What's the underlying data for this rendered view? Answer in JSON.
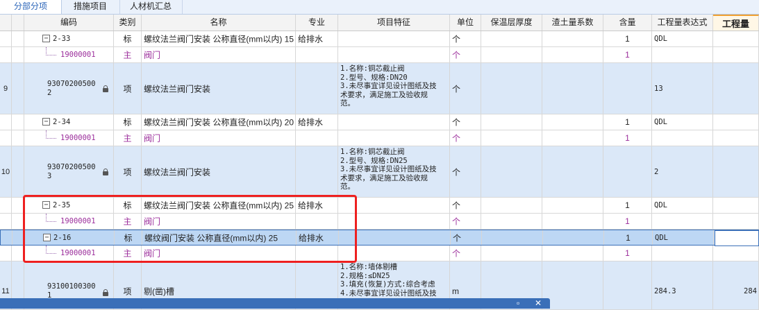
{
  "tabs": [
    {
      "label": "分部分项"
    },
    {
      "label": "措施项目"
    },
    {
      "label": "人材机汇总"
    }
  ],
  "columns": {
    "code": "编码",
    "category": "类别",
    "name": "名称",
    "specialty": "专业",
    "feature": "项目特征",
    "unit": "单位",
    "insulation": "保温层厚度",
    "soil": "渣土量系数",
    "content": "含量",
    "expr": "工程量表达式",
    "qty": "工程量"
  },
  "rows": [
    {
      "num": "",
      "code": "2-33",
      "category": "标",
      "name": "螺纹法兰阀门安装 公称直径(mm以内) 15",
      "specialty": "给排水",
      "unit": "个",
      "content": "1",
      "expr": "QDL",
      "qty": ""
    },
    {
      "num": "",
      "code": "19000001",
      "category": "主",
      "name": "阀门",
      "unit": "个",
      "content": "1"
    },
    {
      "num": "9",
      "code_l1": "93070200500",
      "code_l2": "2",
      "category": "项",
      "name": "螺纹法兰阀门安装",
      "feature": [
        "1.名称:铜芯截止阀",
        "2.型号、规格:DN20",
        "3.未尽事宜详见设计图纸及技",
        "术要求，满足施工及验收规",
        "范。"
      ],
      "unit": "个",
      "expr": "13",
      "qty": ""
    },
    {
      "num": "",
      "code": "2-34",
      "category": "标",
      "name": "螺纹法兰阀门安装 公称直径(mm以内) 20",
      "specialty": "给排水",
      "unit": "个",
      "content": "1",
      "expr": "QDL",
      "qty": ""
    },
    {
      "num": "",
      "code": "19000001",
      "category": "主",
      "name": "阀门",
      "unit": "个",
      "content": "1"
    },
    {
      "num": "10",
      "code_l1": "93070200500",
      "code_l2": "3",
      "category": "项",
      "name": "螺纹法兰阀门安装",
      "feature": [
        "1.名称:铜芯截止阀",
        "2.型号、规格:DN25",
        "3.未尽事宜详见设计图纸及技",
        "术要求，满足施工及验收规",
        "范。"
      ],
      "unit": "个",
      "expr": "2",
      "qty": ""
    },
    {
      "num": "",
      "code": "2-35",
      "category": "标",
      "name": "螺纹法兰阀门安装 公称直径(mm以内) 25",
      "specialty": "给排水",
      "unit": "个",
      "content": "1",
      "expr": "QDL",
      "qty": ""
    },
    {
      "num": "",
      "code": "19000001",
      "category": "主",
      "name": "阀门",
      "unit": "个",
      "content": "1"
    },
    {
      "num": "",
      "code": "2-16",
      "category": "标",
      "name": "螺纹阀门安装 公称直径(mm以内) 25",
      "specialty": "给排水",
      "unit": "个",
      "content": "1",
      "expr": "QDL",
      "qty": ""
    },
    {
      "num": "",
      "code": "19000001",
      "category": "主",
      "name": "阀门",
      "unit": "个",
      "content": "1"
    },
    {
      "num": "11",
      "code_l1": "93100100300",
      "code_l2": "1",
      "category": "项",
      "name": "剔(凿)槽",
      "feature": [
        "1.名称:墙体剔槽",
        "2.规格:≤DN25",
        "3.填充(恢复)方式:综合考虑",
        "4.未尽事宜详见设计图纸及技"
      ],
      "unit": "m",
      "expr": "284.3",
      "qty": "284"
    }
  ],
  "colors": {
    "accent": "#3a6fb8",
    "highlight_box": "#ee2020",
    "sub_text": "#9b2d9b",
    "item_row": "#dbe8f8",
    "selected_row": "#bdd7f4"
  },
  "bottom_icons": [
    "restore-icon",
    "close-icon"
  ]
}
